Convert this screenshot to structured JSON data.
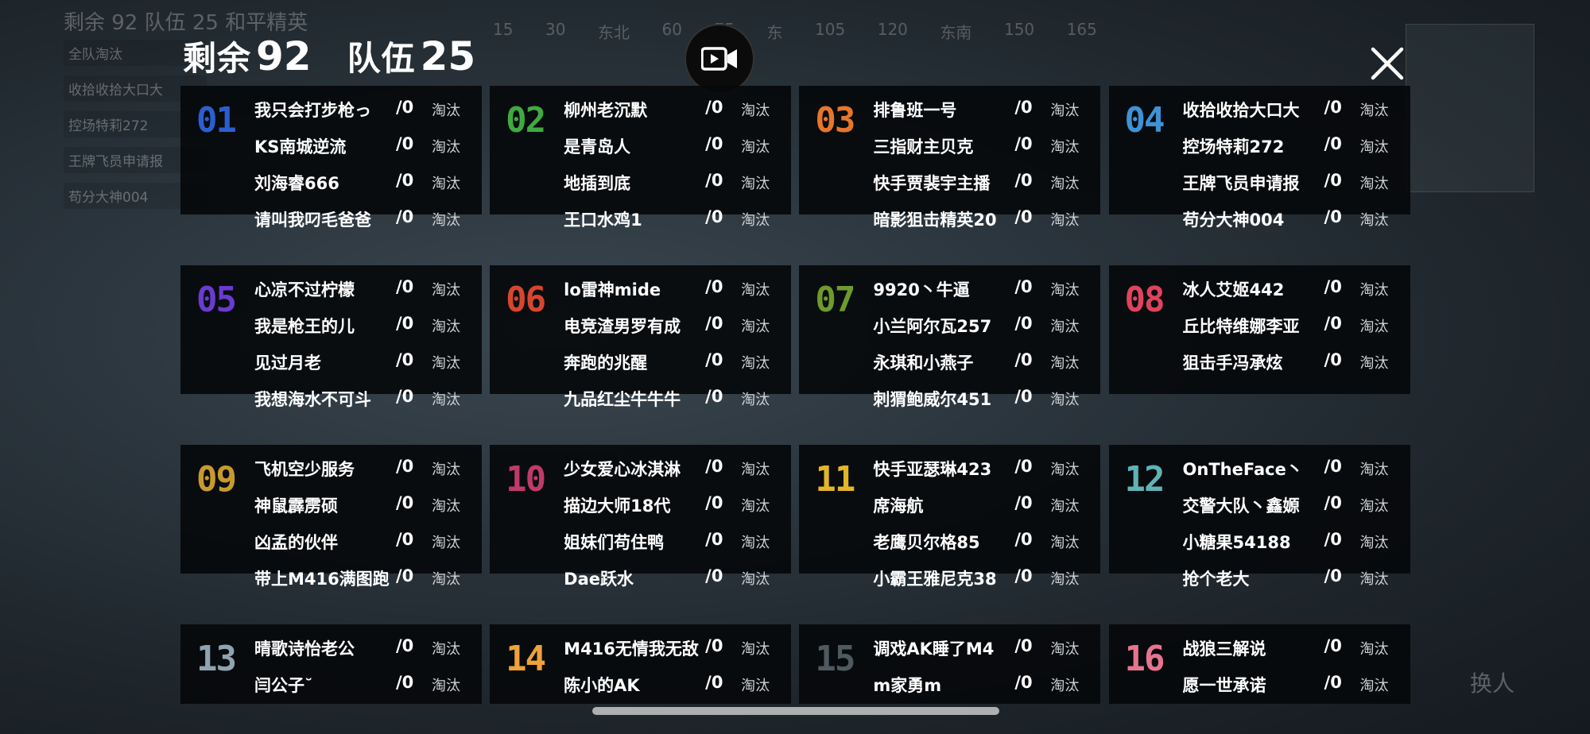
{
  "background": {
    "top_stat": "剩余 92  队伍 25  和平精英",
    "compass": [
      "15",
      "30",
      "东北",
      "60",
      "75",
      "东",
      "105",
      "120",
      "东南",
      "150",
      "165"
    ],
    "side_items": [
      "全队淘汰",
      "收拾收拾大口大",
      "控场特莉272",
      "王牌飞员申请报",
      "苟分大神004"
    ],
    "swap_label": "换人"
  },
  "header": {
    "remaining_label": "剩余",
    "remaining_value": "92",
    "teams_label": "队伍",
    "teams_value": "25"
  },
  "controls": {
    "record_icon": "video-camera-icon",
    "close_icon": "close-icon"
  },
  "eliminated_label": "淘汰",
  "teams": [
    {
      "number": "01",
      "color": "#2b5fd1",
      "players": [
        {
          "name": "我只会打步枪っ",
          "kills": "/0"
        },
        {
          "name": "KS南城逆流",
          "kills": "/0"
        },
        {
          "name": "刘海睿666",
          "kills": "/0"
        },
        {
          "name": "请叫我叼毛爸爸",
          "kills": "/0"
        }
      ]
    },
    {
      "number": "02",
      "color": "#3faa3f",
      "players": [
        {
          "name": "柳州老沉默",
          "kills": "/0"
        },
        {
          "name": "是青岛人",
          "kills": "/0"
        },
        {
          "name": "地插到底",
          "kills": "/0"
        },
        {
          "name": "王口水鸡1",
          "kills": "/0"
        }
      ]
    },
    {
      "number": "03",
      "color": "#e6762b",
      "players": [
        {
          "name": "排鲁班一号",
          "kills": "/0"
        },
        {
          "name": "三指财主贝克",
          "kills": "/0"
        },
        {
          "name": "快手贾裴宇主播",
          "kills": "/0"
        },
        {
          "name": "暗影狙击精英20",
          "kills": "/0"
        }
      ]
    },
    {
      "number": "04",
      "color": "#3f92d6",
      "players": [
        {
          "name": "收拾收拾大口大",
          "kills": "/0"
        },
        {
          "name": "控场特莉272",
          "kills": "/0"
        },
        {
          "name": "王牌飞员申请报",
          "kills": "/0"
        },
        {
          "name": "苟分大神004",
          "kills": "/0"
        }
      ]
    },
    {
      "number": "05",
      "color": "#6a3bd0",
      "players": [
        {
          "name": "心凉不过柠檬",
          "kills": "/0"
        },
        {
          "name": "我是枪王的儿",
          "kills": "/0"
        },
        {
          "name": "见过月老",
          "kills": "/0"
        },
        {
          "name": "我想海水不可斗",
          "kills": "/0"
        }
      ]
    },
    {
      "number": "06",
      "color": "#d8452e",
      "players": [
        {
          "name": "lo雷神mide",
          "kills": "/0"
        },
        {
          "name": "电竞渣男罗有成",
          "kills": "/0"
        },
        {
          "name": "奔跑的兆醒",
          "kills": "/0"
        },
        {
          "name": "九品红尘牛牛牛",
          "kills": "/0"
        }
      ]
    },
    {
      "number": "07",
      "color": "#6f9a2c",
      "players": [
        {
          "name": "9920丶牛逼",
          "kills": "/0"
        },
        {
          "name": "小兰阿尔瓦257",
          "kills": "/0"
        },
        {
          "name": "永琪和小燕子",
          "kills": "/0"
        },
        {
          "name": "刺猬鲍威尔451",
          "kills": "/0"
        }
      ]
    },
    {
      "number": "08",
      "color": "#e0435d",
      "players": [
        {
          "name": "冰人艾姬442",
          "kills": "/0"
        },
        {
          "name": "丘比特维娜李亚",
          "kills": "/0"
        },
        {
          "name": "狙击手冯承炫",
          "kills": "/0"
        }
      ]
    },
    {
      "number": "09",
      "color": "#c79a2e",
      "players": [
        {
          "name": "飞机空少服务",
          "kills": "/0"
        },
        {
          "name": "神鼠霹雳硕",
          "kills": "/0"
        },
        {
          "name": "凶孟的伙伴",
          "kills": "/0"
        },
        {
          "name": "带上M416满图跑",
          "kills": "/0"
        }
      ]
    },
    {
      "number": "10",
      "color": "#c03a68",
      "players": [
        {
          "name": "少女爱心冰淇淋",
          "kills": "/0"
        },
        {
          "name": "描边大师18代",
          "kills": "/0"
        },
        {
          "name": "姐妹们苟住鸭",
          "kills": "/0"
        },
        {
          "name": "Dae跃水",
          "kills": "/0"
        }
      ]
    },
    {
      "number": "11",
      "color": "#e1b628",
      "players": [
        {
          "name": "快手亚瑟琳423",
          "kills": "/0"
        },
        {
          "name": "席海航",
          "kills": "/0"
        },
        {
          "name": "老鹰贝尔格85",
          "kills": "/0"
        },
        {
          "name": "小霸王雅尼克38",
          "kills": "/0"
        }
      ]
    },
    {
      "number": "12",
      "color": "#5fb3b5",
      "players": [
        {
          "name": "OnTheFace丶",
          "kills": "/0"
        },
        {
          "name": "交警大队丶鑫嫄",
          "kills": "/0"
        },
        {
          "name": "小糖果54188",
          "kills": "/0"
        },
        {
          "name": "抢个老大",
          "kills": "/0"
        }
      ]
    },
    {
      "number": "13",
      "color": "#8fa3b0",
      "players": [
        {
          "name": "晴歌诗怡老公",
          "kills": "/0"
        },
        {
          "name": "闫公子˘",
          "kills": "/0"
        }
      ]
    },
    {
      "number": "14",
      "color": "#eea23a",
      "players": [
        {
          "name": "M416无情我无敌",
          "kills": "/0"
        },
        {
          "name": "陈小的AK",
          "kills": "/0"
        }
      ]
    },
    {
      "number": "15",
      "color": "#4f5a60",
      "players": [
        {
          "name": "调戏AK睡了M4",
          "kills": "/0"
        },
        {
          "name": "m家勇m",
          "kills": "/0"
        }
      ]
    },
    {
      "number": "16",
      "color": "#e7748f",
      "players": [
        {
          "name": "战狼三解说",
          "kills": "/0"
        },
        {
          "name": "愿一世承诺",
          "kills": "/0"
        }
      ]
    }
  ]
}
